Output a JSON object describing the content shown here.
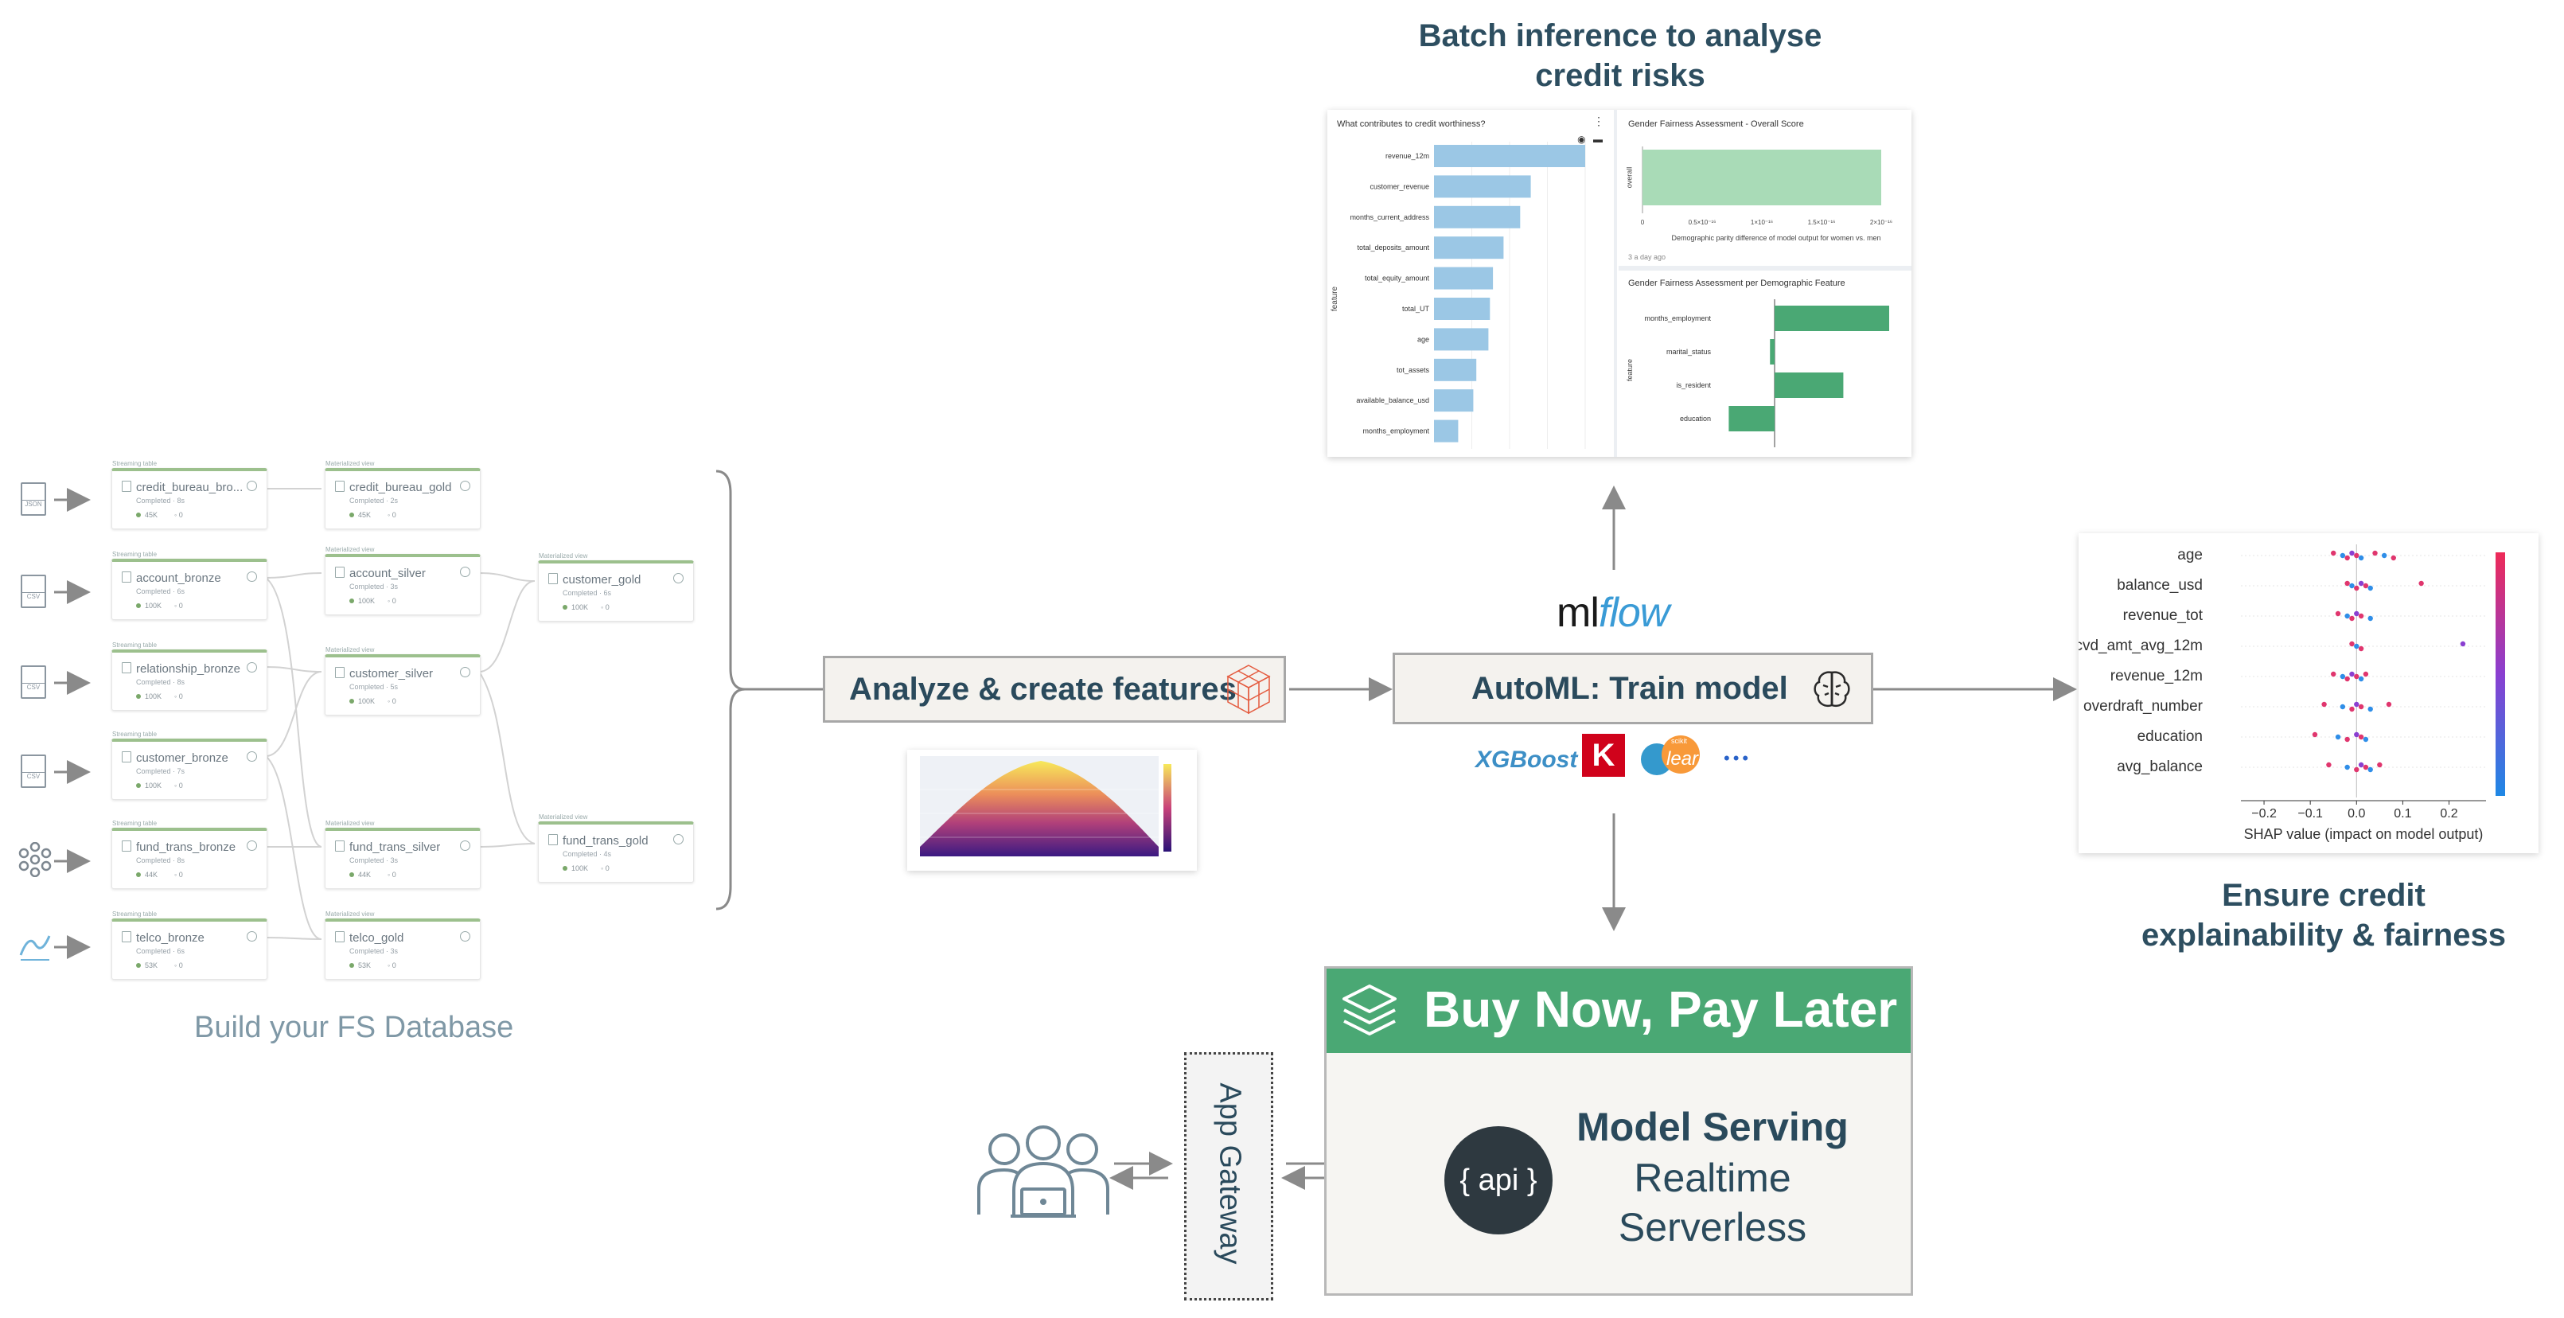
{
  "headings": {
    "batch_inference": [
      "Batch inference to analyse",
      "credit risks"
    ],
    "explainability": [
      "Ensure credit",
      "explainability & fairness"
    ],
    "fs_database": "Build your FS Database"
  },
  "pipeline": {
    "sources": [
      {
        "icon": "json-file-icon",
        "label": "JSON"
      },
      {
        "icon": "csv-file-icon",
        "label": "CSV"
      },
      {
        "icon": "csv-file-icon",
        "label": "CSV"
      },
      {
        "icon": "csv-file-icon",
        "label": "CSV"
      },
      {
        "icon": "kafka-icon",
        "label": ""
      },
      {
        "icon": "kinesis-icon",
        "label": ""
      }
    ],
    "nodes": [
      {
        "type": "Streaming table",
        "name": "credit_bureau_bro...",
        "sub": "Completed · 8s",
        "rows": "45K",
        "errors": "0"
      },
      {
        "type": "Streaming table",
        "name": "account_bronze",
        "sub": "Completed · 6s",
        "rows": "100K",
        "errors": "0"
      },
      {
        "type": "Streaming table",
        "name": "relationship_bronze",
        "sub": "Completed · 8s",
        "rows": "100K",
        "errors": "0"
      },
      {
        "type": "Streaming table",
        "name": "customer_bronze",
        "sub": "Completed · 7s",
        "rows": "100K",
        "errors": "0"
      },
      {
        "type": "Streaming table",
        "name": "fund_trans_bronze",
        "sub": "Completed · 8s",
        "rows": "44K",
        "errors": "0"
      },
      {
        "type": "Streaming table",
        "name": "telco_bronze",
        "sub": "Completed · 6s",
        "rows": "53K",
        "errors": "0"
      },
      {
        "type": "Materialized view",
        "name": "credit_bureau_gold",
        "sub": "Completed · 2s",
        "rows": "45K",
        "errors": "0"
      },
      {
        "type": "Materialized view",
        "name": "account_silver",
        "sub": "Completed · 3s",
        "rows": "100K",
        "errors": "0"
      },
      {
        "type": "Materialized view",
        "name": "customer_silver",
        "sub": "Completed · 5s",
        "rows": "100K",
        "errors": "0"
      },
      {
        "type": "Materialized view",
        "name": "fund_trans_silver",
        "sub": "Completed · 3s",
        "rows": "44K",
        "errors": "0"
      },
      {
        "type": "Materialized view",
        "name": "telco_gold",
        "sub": "Completed · 3s",
        "rows": "53K",
        "errors": "0"
      },
      {
        "type": "Materialized view",
        "name": "customer_gold",
        "sub": "Completed · 6s",
        "rows": "100K",
        "errors": "0"
      },
      {
        "type": "Materialized view",
        "name": "fund_trans_gold",
        "sub": "Completed · 4s",
        "rows": "100K",
        "errors": "0"
      }
    ]
  },
  "steps": {
    "analyze": "Analyze & create features",
    "automl": "AutoML: Train model",
    "mlflow": {
      "ml": "ml",
      "flow": "flow"
    },
    "libraries": {
      "xgboost": "XGBoost",
      "keras": "K",
      "sklearn_small": "scikit",
      "sklearn": "learn",
      "more": "•••"
    }
  },
  "dashboard": {
    "credit_chart": {
      "title": "What contributes to credit worthiness?",
      "ylabel": "feature"
    },
    "fairness_overall": {
      "title": "Gender Fairness Assessment - Overall Score",
      "ylabel": "overall",
      "xlabel": "Demographic parity difference of model output for women vs. men",
      "ticks": [
        "0",
        "0.5×10⁻¹⁶",
        "1×10⁻¹⁶",
        "1.5×10⁻¹⁶",
        "2×10⁻¹⁶"
      ],
      "footer": "3 a day ago"
    },
    "fairness_feature": {
      "title": "Gender Fairness Assessment per Demographic Feature",
      "ylabel": "feature"
    }
  },
  "serving": {
    "banner": "Buy Now, Pay Later",
    "title": "Model Serving",
    "line1": "Realtime",
    "line2": "Serverless",
    "api": "{ api }",
    "gateway": "App Gateway"
  },
  "colors": {
    "node_border": "#9cc08d",
    "banner_green": "#4aa874",
    "bar_blue": "#9bc7e5",
    "fair_green": "#4aa874",
    "fair_light": "#a9dbb7",
    "heading": "#2d4e60"
  },
  "chart_data": [
    {
      "type": "bar",
      "title": "What contributes to credit worthiness?",
      "ylabel": "feature",
      "orientation": "horizontal",
      "categories": [
        "revenue_12m",
        "customer_revenue",
        "months_current_address",
        "total_deposits_amount",
        "total_equity_amount",
        "total_UT",
        "age",
        "tot_assets",
        "available_balance_usd",
        "months_employment"
      ],
      "values": [
        1.0,
        0.64,
        0.57,
        0.46,
        0.39,
        0.37,
        0.36,
        0.28,
        0.26,
        0.16
      ]
    },
    {
      "type": "bar",
      "title": "Gender Fairness Assessment - Overall Score",
      "orientation": "horizontal",
      "categories": [
        "overall"
      ],
      "values": [
        2e-16
      ],
      "xlim": [
        0,
        2e-16
      ]
    },
    {
      "type": "bar",
      "title": "Gender Fairness Assessment per Demographic Feature",
      "ylabel": "feature",
      "orientation": "horizontal",
      "categories": [
        "months_employment",
        "marital_status",
        "is_resident",
        "education"
      ],
      "values": [
        0.5,
        -0.02,
        0.3,
        -0.2
      ]
    },
    {
      "type": "scatter",
      "xlabel": "SHAP value (impact on model output)",
      "xlim": [
        -0.25,
        0.28
      ],
      "ticks": [
        "−0.2",
        "−0.1",
        "0.0",
        "0.1",
        "0.2"
      ],
      "tick_values": [
        -0.2,
        -0.1,
        0.0,
        0.1,
        0.2
      ],
      "categories": [
        "age",
        "balance_usd",
        "revenue_tot",
        "rcvd_amt_avg_12m",
        "revenue_12m",
        "overdraft_number",
        "education",
        "avg_balance"
      ],
      "series": [
        {
          "feature": "age",
          "values": [
            -0.05,
            -0.03,
            -0.02,
            -0.01,
            0.0,
            0.01,
            0.04,
            0.06,
            0.08
          ]
        },
        {
          "feature": "balance_usd",
          "values": [
            -0.02,
            -0.01,
            0.0,
            0.01,
            0.02,
            0.03,
            0.14
          ]
        },
        {
          "feature": "revenue_tot",
          "values": [
            -0.04,
            -0.02,
            -0.01,
            0.0,
            0.01,
            0.03
          ]
        },
        {
          "feature": "rcvd_amt_avg_12m",
          "values": [
            -0.01,
            0.0,
            0.01,
            0.23
          ]
        },
        {
          "feature": "revenue_12m",
          "values": [
            -0.05,
            -0.03,
            -0.02,
            -0.01,
            0.0,
            0.01,
            0.02
          ]
        },
        {
          "feature": "overdraft_number",
          "values": [
            -0.07,
            -0.03,
            -0.01,
            0.0,
            0.01,
            0.03,
            0.07
          ]
        },
        {
          "feature": "education",
          "values": [
            -0.09,
            -0.04,
            -0.02,
            0.0,
            0.01,
            0.02
          ]
        },
        {
          "feature": "avg_balance",
          "values": [
            -0.06,
            -0.02,
            0.0,
            0.01,
            0.02,
            0.03,
            0.05
          ]
        }
      ]
    }
  ]
}
